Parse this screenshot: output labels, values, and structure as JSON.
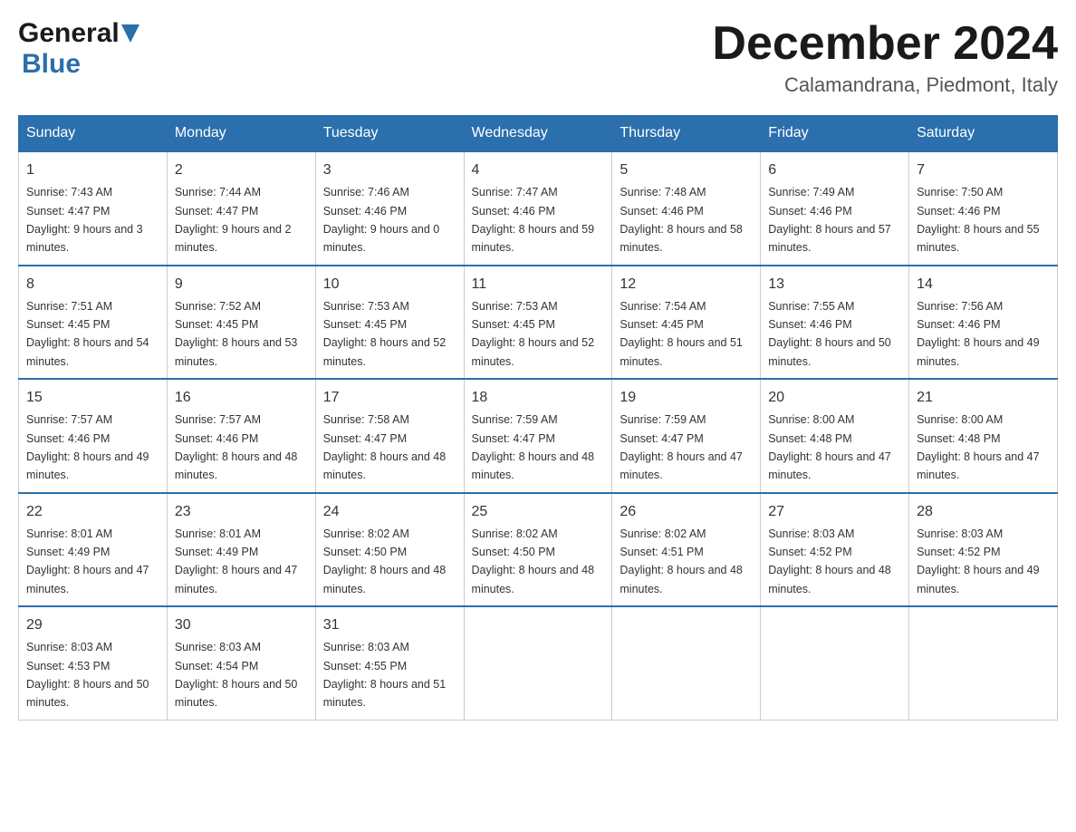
{
  "logo": {
    "general": "General",
    "blue": "Blue",
    "arrow": "▲"
  },
  "title": "December 2024",
  "location": "Calamandrana, Piedmont, Italy",
  "weekdays": [
    "Sunday",
    "Monday",
    "Tuesday",
    "Wednesday",
    "Thursday",
    "Friday",
    "Saturday"
  ],
  "weeks": [
    [
      {
        "day": "1",
        "sunrise": "7:43 AM",
        "sunset": "4:47 PM",
        "daylight": "9 hours and 3 minutes."
      },
      {
        "day": "2",
        "sunrise": "7:44 AM",
        "sunset": "4:47 PM",
        "daylight": "9 hours and 2 minutes."
      },
      {
        "day": "3",
        "sunrise": "7:46 AM",
        "sunset": "4:46 PM",
        "daylight": "9 hours and 0 minutes."
      },
      {
        "day": "4",
        "sunrise": "7:47 AM",
        "sunset": "4:46 PM",
        "daylight": "8 hours and 59 minutes."
      },
      {
        "day": "5",
        "sunrise": "7:48 AM",
        "sunset": "4:46 PM",
        "daylight": "8 hours and 58 minutes."
      },
      {
        "day": "6",
        "sunrise": "7:49 AM",
        "sunset": "4:46 PM",
        "daylight": "8 hours and 57 minutes."
      },
      {
        "day": "7",
        "sunrise": "7:50 AM",
        "sunset": "4:46 PM",
        "daylight": "8 hours and 55 minutes."
      }
    ],
    [
      {
        "day": "8",
        "sunrise": "7:51 AM",
        "sunset": "4:45 PM",
        "daylight": "8 hours and 54 minutes."
      },
      {
        "day": "9",
        "sunrise": "7:52 AM",
        "sunset": "4:45 PM",
        "daylight": "8 hours and 53 minutes."
      },
      {
        "day": "10",
        "sunrise": "7:53 AM",
        "sunset": "4:45 PM",
        "daylight": "8 hours and 52 minutes."
      },
      {
        "day": "11",
        "sunrise": "7:53 AM",
        "sunset": "4:45 PM",
        "daylight": "8 hours and 52 minutes."
      },
      {
        "day": "12",
        "sunrise": "7:54 AM",
        "sunset": "4:45 PM",
        "daylight": "8 hours and 51 minutes."
      },
      {
        "day": "13",
        "sunrise": "7:55 AM",
        "sunset": "4:46 PM",
        "daylight": "8 hours and 50 minutes."
      },
      {
        "day": "14",
        "sunrise": "7:56 AM",
        "sunset": "4:46 PM",
        "daylight": "8 hours and 49 minutes."
      }
    ],
    [
      {
        "day": "15",
        "sunrise": "7:57 AM",
        "sunset": "4:46 PM",
        "daylight": "8 hours and 49 minutes."
      },
      {
        "day": "16",
        "sunrise": "7:57 AM",
        "sunset": "4:46 PM",
        "daylight": "8 hours and 48 minutes."
      },
      {
        "day": "17",
        "sunrise": "7:58 AM",
        "sunset": "4:47 PM",
        "daylight": "8 hours and 48 minutes."
      },
      {
        "day": "18",
        "sunrise": "7:59 AM",
        "sunset": "4:47 PM",
        "daylight": "8 hours and 48 minutes."
      },
      {
        "day": "19",
        "sunrise": "7:59 AM",
        "sunset": "4:47 PM",
        "daylight": "8 hours and 47 minutes."
      },
      {
        "day": "20",
        "sunrise": "8:00 AM",
        "sunset": "4:48 PM",
        "daylight": "8 hours and 47 minutes."
      },
      {
        "day": "21",
        "sunrise": "8:00 AM",
        "sunset": "4:48 PM",
        "daylight": "8 hours and 47 minutes."
      }
    ],
    [
      {
        "day": "22",
        "sunrise": "8:01 AM",
        "sunset": "4:49 PM",
        "daylight": "8 hours and 47 minutes."
      },
      {
        "day": "23",
        "sunrise": "8:01 AM",
        "sunset": "4:49 PM",
        "daylight": "8 hours and 47 minutes."
      },
      {
        "day": "24",
        "sunrise": "8:02 AM",
        "sunset": "4:50 PM",
        "daylight": "8 hours and 48 minutes."
      },
      {
        "day": "25",
        "sunrise": "8:02 AM",
        "sunset": "4:50 PM",
        "daylight": "8 hours and 48 minutes."
      },
      {
        "day": "26",
        "sunrise": "8:02 AM",
        "sunset": "4:51 PM",
        "daylight": "8 hours and 48 minutes."
      },
      {
        "day": "27",
        "sunrise": "8:03 AM",
        "sunset": "4:52 PM",
        "daylight": "8 hours and 48 minutes."
      },
      {
        "day": "28",
        "sunrise": "8:03 AM",
        "sunset": "4:52 PM",
        "daylight": "8 hours and 49 minutes."
      }
    ],
    [
      {
        "day": "29",
        "sunrise": "8:03 AM",
        "sunset": "4:53 PM",
        "daylight": "8 hours and 50 minutes."
      },
      {
        "day": "30",
        "sunrise": "8:03 AM",
        "sunset": "4:54 PM",
        "daylight": "8 hours and 50 minutes."
      },
      {
        "day": "31",
        "sunrise": "8:03 AM",
        "sunset": "4:55 PM",
        "daylight": "8 hours and 51 minutes."
      },
      null,
      null,
      null,
      null
    ]
  ]
}
